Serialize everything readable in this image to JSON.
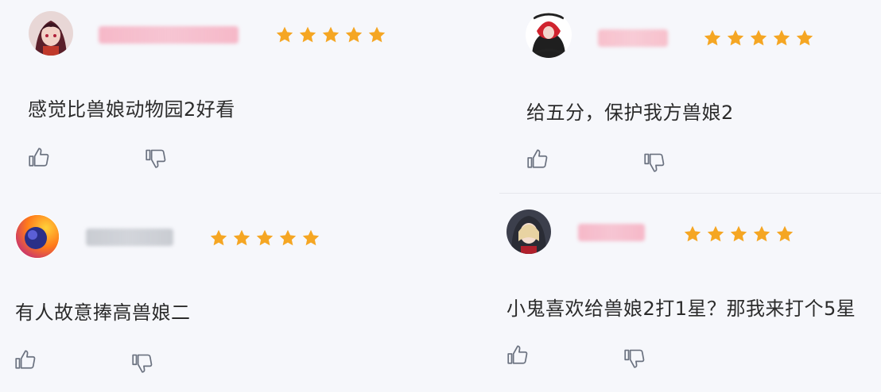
{
  "comments": [
    {
      "text": "感觉比兽娘动物园2好看",
      "rating": 5,
      "avatar_icon": "anime-girl-avatar",
      "name_blur_color": "#f6b8c8"
    },
    {
      "text": "给五分，保护我方兽娘2",
      "rating": 5,
      "avatar_icon": "red-hood-character-avatar",
      "name_blur_color": "#f7c0cc"
    },
    {
      "text": "有人故意捧高兽娘二",
      "rating": 5,
      "avatar_icon": "orange-globe-logo-avatar",
      "name_blur_color": "#c9ccd2"
    },
    {
      "text": "小鬼喜欢给兽娘2打1星？那我来打个5星",
      "rating": 5,
      "avatar_icon": "hooded-character-avatar",
      "name_blur_color": "#f6b8c8"
    }
  ],
  "colors": {
    "star": "#f5a623",
    "icon_stroke": "#6b7280",
    "text": "#2b2b2b"
  },
  "icons": {
    "like": "thumbs-up-icon",
    "dislike": "thumbs-down-icon",
    "rating": "star-icon"
  }
}
